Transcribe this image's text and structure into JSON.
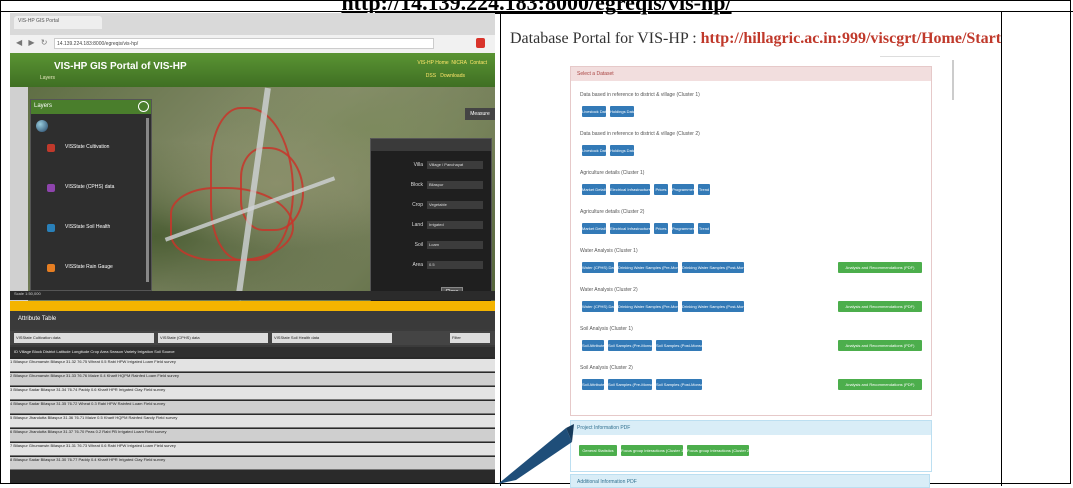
{
  "page": {
    "top_url": "http://14.139.224.183:8000/egreqis/vis-hp/"
  },
  "gis": {
    "browser_tab": "VIS-HP GIS Portal",
    "address": "14.139.224.183:8000/egreqis/vis-hp/",
    "app_title": "VIS-HP GIS Portal of VIS-HP",
    "app_subtitle": "Layers",
    "header_links": [
      "VIS-HP Home",
      "NICRA",
      "Contact"
    ],
    "header_links2": [
      "DSS",
      "Downloads"
    ],
    "layers_title": "Layers",
    "layers": [
      {
        "label": "VISState Cultivation",
        "color": "#c0392b"
      },
      {
        "label": "VISState (CPHS) data",
        "color": "#8e44ad"
      },
      {
        "label": "VISState Soil Health",
        "color": "#2980b9"
      },
      {
        "label": "VISState Rain Gauge",
        "color": "#e67e22"
      }
    ],
    "info_rows": [
      {
        "label": "Villa",
        "value": "Village / Panchayat"
      },
      {
        "label": "Block",
        "value": "Bilaspur"
      },
      {
        "label": "Crop",
        "value": "Vegetable"
      },
      {
        "label": "Land",
        "value": "Irrigated"
      },
      {
        "label": "Soil",
        "value": "Loam"
      },
      {
        "label": "Area",
        "value": "0.5"
      }
    ],
    "info_button": "Close",
    "measure_button": "Measure",
    "status_strip": "Scale 1:50,000",
    "attr_title": "Attribute Table",
    "tabs": [
      "VISState Cultivation data",
      "VISState (CPHS) data",
      "VISState Soil Health data",
      "Filter"
    ],
    "grid_header": "ID  Village  Block  District  Latitude  Longitude  Crop  Area  Season  Variety  Irrigation  Soil  Source",
    "grid_rows": [
      "1  Bilaspur  Ghumarwin  Bilaspur  31.32  76.75  Wheat  0.5  Rabi  HPW  Irrigated  Loam  Field survey",
      "2  Bilaspur  Ghumarwin  Bilaspur  31.33  76.76  Maize  0.4  Kharif  HQPM  Rainfed  Loam  Field survey",
      "3  Bilaspur  Sadar  Bilaspur  31.34  76.74  Paddy  0.6  Kharif  HPR  Irrigated  Clay  Field survey",
      "4  Bilaspur  Sadar  Bilaspur  31.35  76.72  Wheat  0.3  Rabi  HPW  Rainfed  Loam  Field survey",
      "5  Bilaspur  Jhandutta  Bilaspur  31.36  76.71  Maize  0.5  Kharif  HQPM  Rainfed  Sandy  Field survey",
      "6  Bilaspur  Jhandutta  Bilaspur  31.37  76.70  Peas  0.2  Rabi  PB  Irrigated  Loam  Field survey",
      "7  Bilaspur  Ghumarwin  Bilaspur  31.31  76.73  Wheat  0.6  Rabi  HPW  Irrigated  Loam  Field survey",
      "8  Bilaspur  Sadar  Bilaspur  31.30  76.77  Paddy  0.4  Kharif  HPR  Irrigated  Clay  Field survey"
    ]
  },
  "portal": {
    "title_prefix": "Database Portal for VIS-HP : ",
    "title_url": "http://hillagric.ac.in:999/viscgrt/Home/Start",
    "panel_heading": "Select a Dataset",
    "sections": [
      {
        "label": "Data based in reference to district & village (Cluster 1)",
        "buttons": [
          "Livestock Data",
          "Holdings Data"
        ],
        "green": ""
      },
      {
        "label": "Data based in reference to district & village (Cluster 2)",
        "buttons": [
          "Livestock Data",
          "Holdings Data"
        ],
        "green": ""
      },
      {
        "label": "Agriculture details (Cluster 1)",
        "buttons": [
          "Market Details",
          "Electrical Infrastructure",
          "Prices",
          "Programmes",
          "Trend"
        ],
        "green": ""
      },
      {
        "label": "Agriculture details (Cluster 2)",
        "buttons": [
          "Market Details",
          "Electrical Infrastructure",
          "Prices",
          "Programmes",
          "Trend"
        ],
        "green": ""
      },
      {
        "label": "Water Analysis (Cluster 1)",
        "buttons": [
          "Water (CPHS) Data",
          "Drinking Water Samples (Pre-Monsoon)",
          "Drinking Water Samples (Post-Monsoon)"
        ],
        "green": "Analysis and Recommendations (PDF)"
      },
      {
        "label": "Water Analysis (Cluster 2)",
        "buttons": [
          "Water (CPHS) Data",
          "Drinking Water Samples (Pre-Monsoon)",
          "Drinking Water Samples (Post-Monsoon)"
        ],
        "green": "Analysis and Recommendations (PDF)"
      },
      {
        "label": "Soil Analysis (Cluster 1)",
        "buttons": [
          "Soil Attributes",
          "Soil Samples (Pre-Monsoon)",
          "Soil Samples (Post-Monsoon)"
        ],
        "green": "Analysis and Recommendations (PDF)"
      },
      {
        "label": "Soil Analysis (Cluster 2)",
        "buttons": [
          "Soil Attributes",
          "Soil Samples (Pre-Monsoon)",
          "Soil Samples (Post-Monsoon)"
        ],
        "green": "Analysis and Recommendations (PDF)"
      }
    ],
    "panel2_heading": "Project Information PDF",
    "panel2_buttons": [
      "General Statistics",
      "Focus group interactions (Cluster 1)",
      "Focus group interactions (Cluster 2)"
    ],
    "panel3_heading": "Additional Information PDF"
  }
}
